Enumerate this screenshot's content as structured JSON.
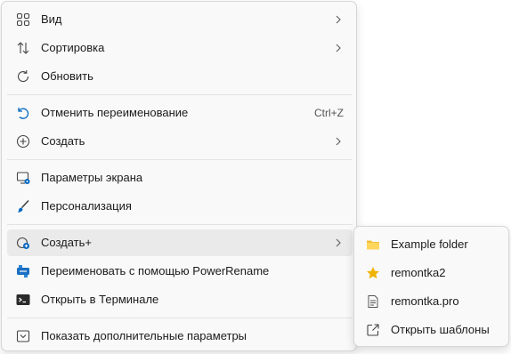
{
  "context_menu": {
    "items": [
      {
        "label": "Вид",
        "icon": "grid-view-icon"
      },
      {
        "label": "Сортировка",
        "icon": "sort-arrows-icon"
      },
      {
        "label": "Обновить",
        "icon": "refresh-icon"
      },
      {
        "label": "Отменить переименование",
        "icon": "undo-icon",
        "shortcut": "Ctrl+Z"
      },
      {
        "label": "Создать",
        "icon": "new-plus-icon"
      },
      {
        "label": "Параметры экрана",
        "icon": "display-settings-icon"
      },
      {
        "label": "Персонализация",
        "icon": "brush-icon"
      },
      {
        "label": "Создать+",
        "icon": "new-plus-badge-icon"
      },
      {
        "label": "Переименовать с помощью PowerRename",
        "icon": "powerrename-icon"
      },
      {
        "label": "Открыть в Терминале",
        "icon": "terminal-icon"
      },
      {
        "label": "Показать дополнительные параметры",
        "icon": "more-options-icon"
      }
    ]
  },
  "submenu": {
    "items": [
      {
        "label": "Example folder",
        "icon": "folder-icon"
      },
      {
        "label": "remontka2",
        "icon": "star-icon"
      },
      {
        "label": "remontka.pro",
        "icon": "document-icon"
      },
      {
        "label": "Открыть шаблоны",
        "icon": "open-external-icon"
      }
    ]
  },
  "colors": {
    "menu_background": "#f9f9f9",
    "highlight": "#eaeaea",
    "accent_blue": "#0067c0",
    "folder_yellow": "#f4c13c",
    "star_gold": "#f0b400"
  }
}
